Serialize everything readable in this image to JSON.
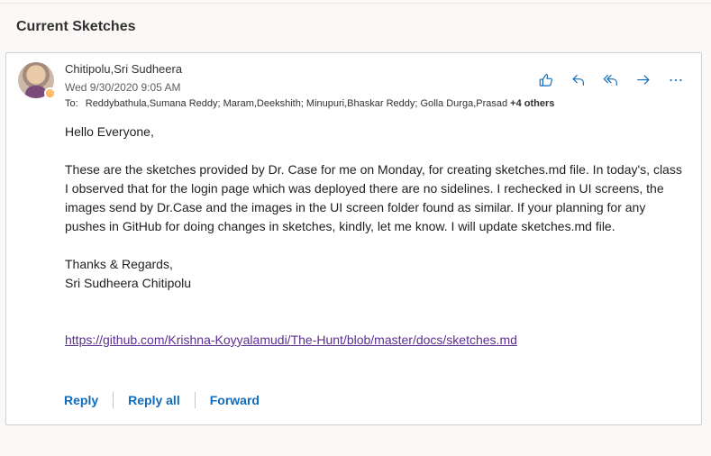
{
  "header": {
    "title": "Current Sketches"
  },
  "message": {
    "sender": "Chitipolu,Sri Sudheera",
    "datetime": "Wed 9/30/2020 9:05 AM",
    "to_label": "To:",
    "recipients": "Reddybathula,Sumana Reddy; Maram,Deekshith; Minupuri,Bhaskar Reddy; Golla Durga,Prasad",
    "others": "+4 others",
    "greeting": "Hello Everyone,",
    "paragraph": "These are the sketches provided by Dr. Case for me on Monday, for creating sketches.md file. In today's, class I observed that for the login page which was deployed there are no sidelines. I rechecked in UI screens, the images send by Dr.Case and the images in the UI screen folder found as similar.  If your planning for any pushes in GitHub for doing changes in sketches, kindly, let me know. I will update sketches.md file.",
    "signoff": "Thanks & Regards,",
    "signature": "Sri Sudheera Chitipolu",
    "link": "https://github.com/Krishna-Koyyalamudi/The-Hunt/blob/master/docs/sketches.md"
  },
  "actions": {
    "like_icon": "thumbs-up-icon",
    "reply_icon": "reply-icon",
    "reply_all_icon": "reply-all-icon",
    "forward_icon": "forward-icon",
    "more_icon": "more-icon"
  },
  "footer": {
    "reply": "Reply",
    "reply_all": "Reply all",
    "forward": "Forward"
  },
  "colors": {
    "accent": "#0f6cbd",
    "link": "#5c2d91",
    "presence": "#ffaa44"
  }
}
